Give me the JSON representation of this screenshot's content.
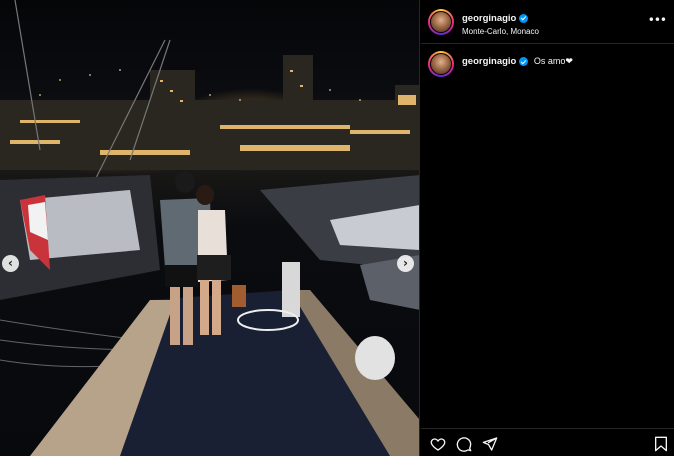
{
  "post": {
    "username": "georginagio",
    "location": "Monte-Carlo, Monaco",
    "caption": "Os amo❤"
  },
  "icons": {
    "verified": "verified-badge-icon",
    "more": "more-options-icon",
    "like": "heart-icon",
    "comment": "comment-icon",
    "share": "share-icon",
    "save": "bookmark-icon",
    "prev": "chevron-left-icon",
    "next": "chevron-right-icon"
  },
  "nav": {
    "prev_glyph": "‹",
    "next_glyph": "›",
    "more_glyph": "•••"
  },
  "colors": {
    "accent": "#0095f6",
    "background": "#000000",
    "divider": "#262626"
  }
}
